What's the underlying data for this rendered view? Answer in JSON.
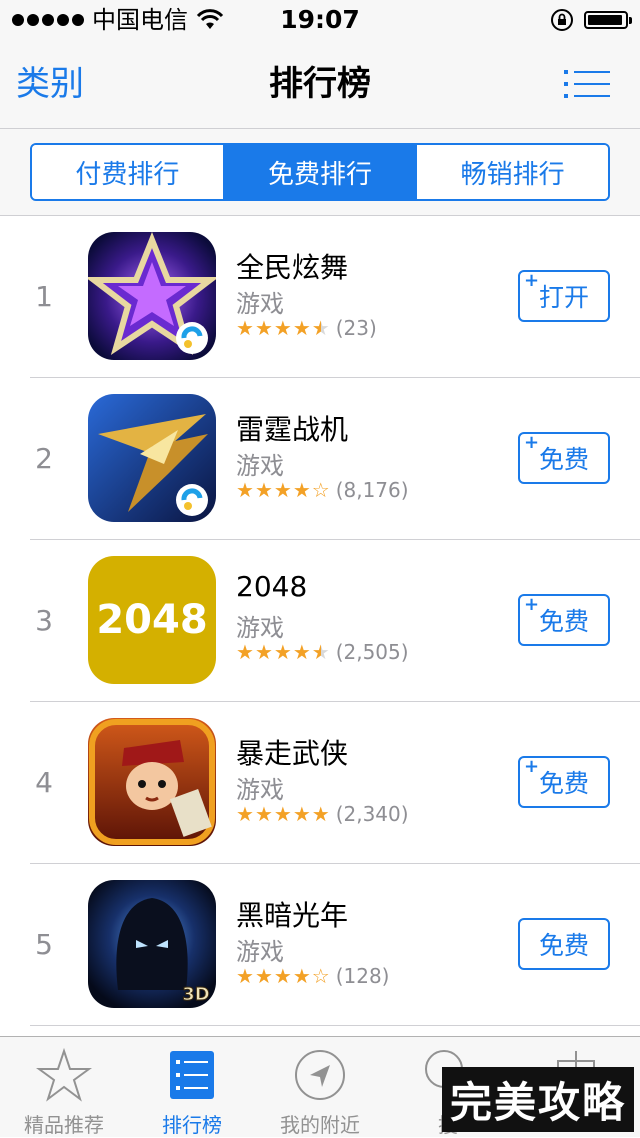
{
  "status_bar": {
    "carrier": "中国电信",
    "time": "19:07",
    "battery_level": 0.95
  },
  "nav": {
    "back_label": "类别",
    "title": "排行榜",
    "list_icon": "list-icon"
  },
  "segments": [
    {
      "label": "付费排行",
      "active": false
    },
    {
      "label": "免费排行",
      "active": true
    },
    {
      "label": "畅销排行",
      "active": false
    }
  ],
  "apps": [
    {
      "rank": "1",
      "name": "全民炫舞",
      "category": "游戏",
      "rating": 4.5,
      "count": "(23)",
      "button": "打开",
      "plus": true,
      "icon": "star-dance-icon"
    },
    {
      "rank": "2",
      "name": "雷霆战机",
      "category": "游戏",
      "rating": 4,
      "count": "(8,176)",
      "button": "免费",
      "plus": true,
      "icon": "fighter-jet-icon"
    },
    {
      "rank": "3",
      "name": "2048",
      "category": "游戏",
      "rating": 4.5,
      "count": "(2,505)",
      "button": "免费",
      "plus": true,
      "icon": "game-2048-icon",
      "icon_text": "2048"
    },
    {
      "rank": "4",
      "name": "暴走武侠",
      "category": "游戏",
      "rating": 5,
      "count": "(2,340)",
      "button": "免费",
      "plus": true,
      "icon": "warrior-character-icon"
    },
    {
      "rank": "5",
      "name": "黑暗光年",
      "category": "游戏",
      "rating": 4,
      "count": "(128)",
      "button": "免费",
      "plus": false,
      "icon": "dark-hooded-figure-icon",
      "icon_badge": "3D"
    }
  ],
  "tabs": [
    {
      "label": "精品推荐",
      "icon": "star-icon",
      "active": false
    },
    {
      "label": "排行榜",
      "icon": "ranking-list-icon",
      "active": true
    },
    {
      "label": "我的附近",
      "icon": "compass-icon",
      "active": false
    },
    {
      "label": "搜",
      "icon": "search-icon",
      "active": false
    },
    {
      "label": "",
      "icon": "download-icon",
      "active": false
    }
  ],
  "watermark": "完美攻略",
  "colors": {
    "accent": "#1a7ae9",
    "star": "#f3a126",
    "secondary_text": "#8e8e93"
  }
}
